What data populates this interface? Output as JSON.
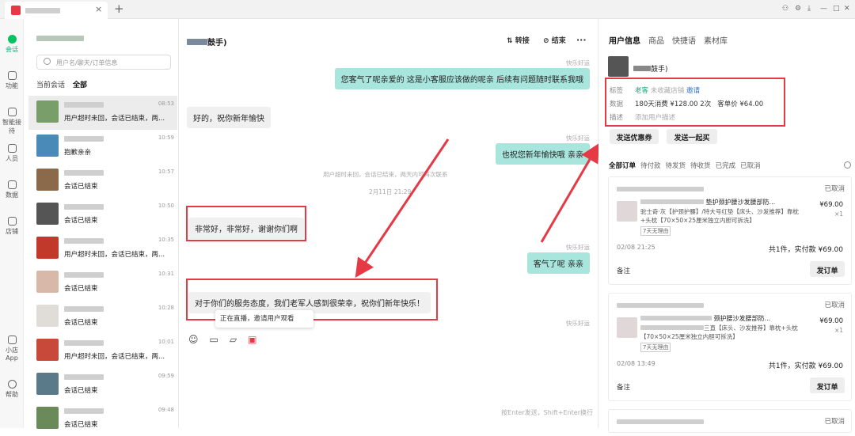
{
  "window": {
    "new_tab": "+",
    "close_tab": "×",
    "controls": [
      "⚇",
      "⚙",
      "⤓",
      "—",
      "□",
      "✕"
    ]
  },
  "nav": {
    "items": [
      {
        "label": "会话",
        "icon": "chat-icon"
      },
      {
        "label": "功能",
        "icon": "grid-icon"
      },
      {
        "label": "智能接待",
        "icon": "robot-icon"
      },
      {
        "label": "人员",
        "icon": "people-icon"
      },
      {
        "label": "数据",
        "icon": "chart-icon"
      },
      {
        "label": "店铺",
        "icon": "store-icon"
      },
      {
        "label": "小店App",
        "icon": "phone-icon"
      },
      {
        "label": "帮助",
        "icon": "help-icon"
      }
    ]
  },
  "list": {
    "search_placeholder": "用户名/聊天/订单信息",
    "filter_current": "当前会话",
    "filter_all": "全部",
    "conversations": [
      {
        "time": "08:53",
        "msg": "用户超时未回，会话已结束，两...",
        "color": "#7a9e6a"
      },
      {
        "time": "10:59",
        "msg": "抱歉亲亲",
        "color": "#4a8ab8"
      },
      {
        "time": "10:57",
        "msg": "会话已结束",
        "color": "#8a6a4a"
      },
      {
        "time": "10:50",
        "msg": "会话已结束",
        "color": "#555555"
      },
      {
        "time": "10:35",
        "msg": "用户超时未回，会话已结束，两...",
        "color": "#c0392b"
      },
      {
        "time": "10:31",
        "msg": "会话已结束",
        "color": "#d8b8a8"
      },
      {
        "time": "10:28",
        "msg": "会话已结束",
        "color": "#e0ddd8"
      },
      {
        "time": "10:01",
        "msg": "用户超时未回，会话已结束，两...",
        "color": "#c8483a"
      },
      {
        "time": "09:59",
        "msg": "会话已结束",
        "color": "#5a7a8a"
      },
      {
        "time": "09:48",
        "msg": "会话已结束",
        "color": "#6a8a5a"
      }
    ]
  },
  "chat": {
    "title_suffix": "鼓手)",
    "transfer": "转接",
    "end": "结束",
    "more": "···",
    "agent_name": "快乐好运",
    "messages": [
      {
        "dir": "out",
        "text": "您客气了呢亲爱的 这是小客服应该做的呢亲 后续有问题随时联系我哦"
      },
      {
        "dir": "in",
        "text": "好的，祝你新年愉快"
      },
      {
        "dir": "out",
        "text": "也祝您新年愉快哦  亲亲"
      },
      {
        "dir": "in",
        "text": "非常好，非常好，谢谢你们啊"
      },
      {
        "dir": "out",
        "text": "客气了呢  亲亲"
      },
      {
        "dir": "in",
        "text": "对于你们的服务态度，我们老军人感到很荣幸，祝你们新年快乐！"
      }
    ],
    "system_note": "用户超时未回，会话已结束，两天内可再次联系",
    "date_note": "2月11日 21:29",
    "tooltip": "正在直播，邀请用户观看",
    "hint": "按Enter发送，Shift+Enter换行"
  },
  "right": {
    "tabs": [
      "用户信息",
      "商品",
      "快捷语",
      "素材库"
    ],
    "user_name_suffix": "鼓手)",
    "tags_label": "标签",
    "tag_old": "老客",
    "tag_unfav": "未收藏店铺",
    "tag_invite": "邀请",
    "data_label": "数据",
    "data_value": "180天消费 ¥128.00  2次",
    "unit_price": "客单价 ¥64.00",
    "desc_label": "描述",
    "desc_placeholder": "添加用户描述",
    "send_coupon": "发送优惠券",
    "send_together": "发送一起买",
    "order_tabs": [
      "全部订单",
      "待付款",
      "待发货",
      "待收货",
      "已完成",
      "已取消"
    ],
    "orders": [
      {
        "status": "已取消",
        "title": "垫护颈护腰沙发腰部防...",
        "desc": "驼士奇·灰【护颈护腰】/特大号红垫【床头、沙发推荐】靠枕+头枕【70×50×25厘米独立内胆可拆洗】",
        "tag": "7天无理由",
        "price": "¥69.00",
        "qty": "×1",
        "time": "02/08 21:25",
        "total": "共1件，实付款 ¥69.00",
        "note": "备注",
        "send": "发订单"
      },
      {
        "status": "已取消",
        "title": "颈护腰沙发腰部防...",
        "desc": "三直【床头、沙发推荐】靠枕+头枕【70×50×25厘米独立内胆可拆洗】",
        "tag": "7天无理由",
        "price": "¥69.00",
        "qty": "×1",
        "time": "02/08 13:49",
        "total": "共1件，实付款 ¥69.00",
        "note": "备注",
        "send": "发订单"
      },
      {
        "status": "已取消"
      }
    ]
  },
  "colors": {
    "accent": "#07c160",
    "annotation": "#e63946",
    "bubble_out": "#a8e6dd"
  }
}
